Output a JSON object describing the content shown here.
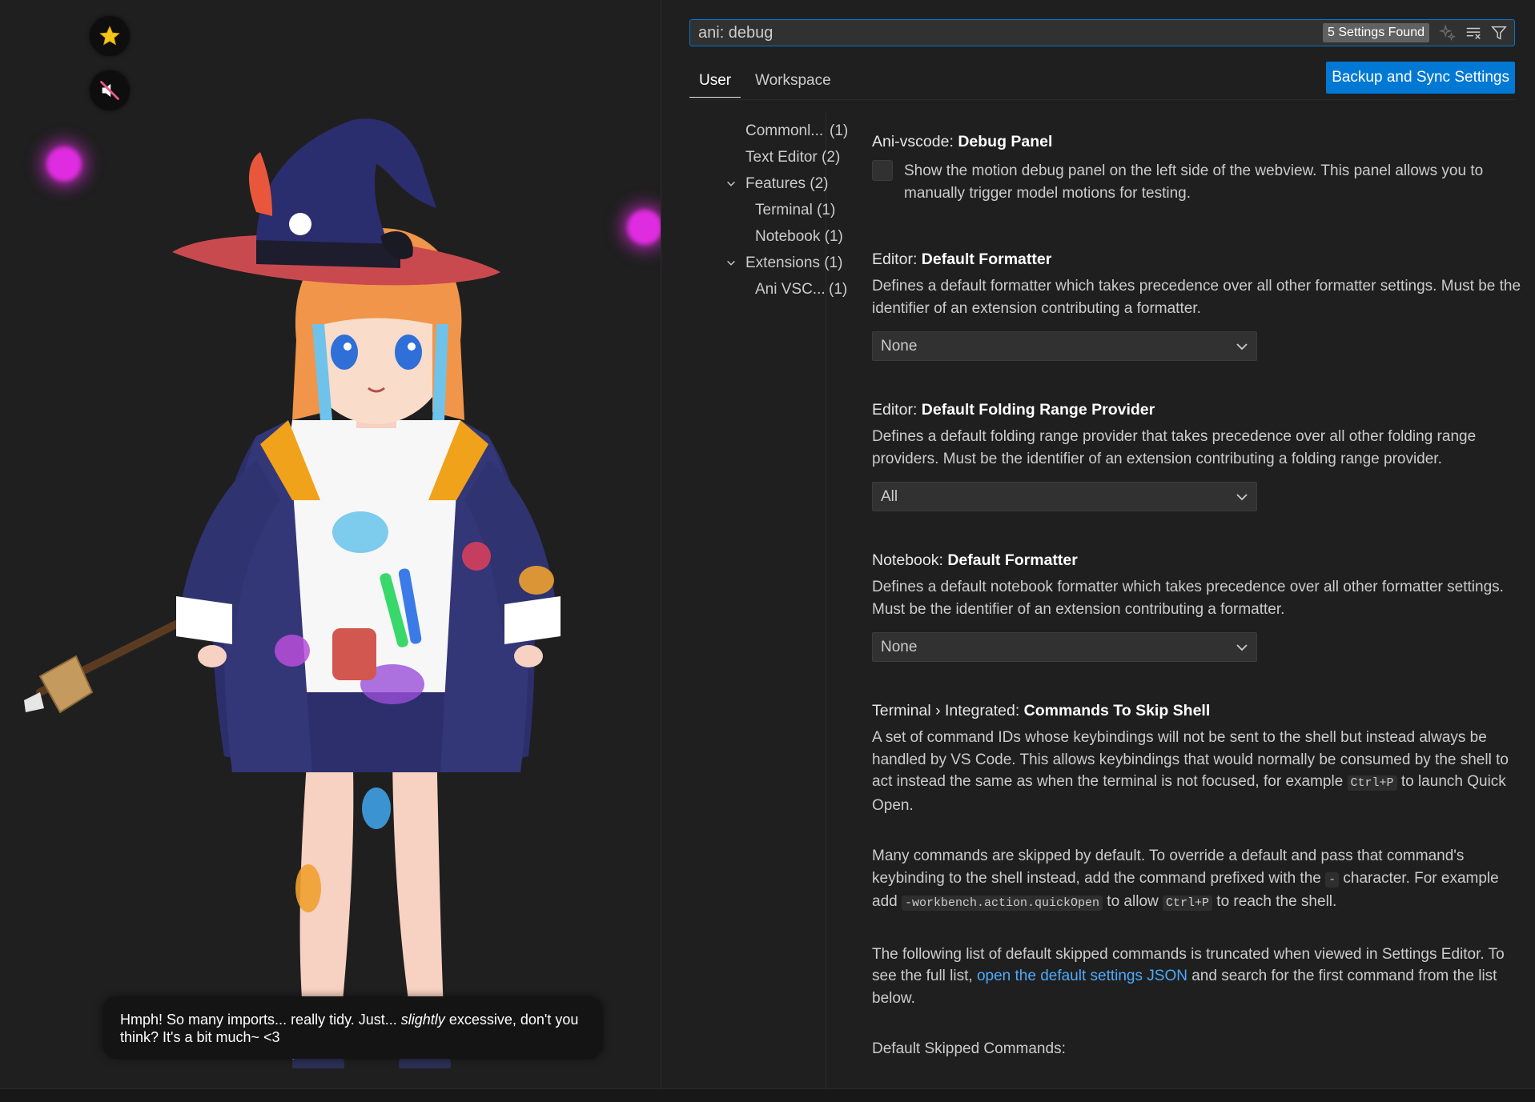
{
  "left_panel": {
    "buttons": [
      {
        "icon": "star-icon",
        "color": "#f5c518"
      },
      {
        "icon": "muted-speaker-icon",
        "color": "#e85a8a"
      }
    ],
    "speech_bubble": {
      "text_before": "Hmph! So many imports... really tidy. Just... ",
      "emphasis": "slightly",
      "text_after": " excessive, don't you think? It's a bit much~ <3"
    }
  },
  "settings_editor": {
    "search": {
      "value": "ani: debug",
      "results_badge": "5 Settings Found",
      "actions": [
        "sparkle-icon",
        "clear-filter-icon",
        "filter-icon"
      ]
    },
    "tabs": [
      {
        "label": "User",
        "active": true
      },
      {
        "label": "Workspace",
        "active": false
      }
    ],
    "sync_button": "Backup and Sync Settings",
    "toc": [
      {
        "label": "Commonl...",
        "count": "(1)"
      },
      {
        "label": "Text Editor",
        "count": "(2)"
      },
      {
        "label": "Features",
        "count": "(2)",
        "expanded": true
      },
      {
        "label": "Terminal",
        "count": "(1)"
      },
      {
        "label": "Notebook",
        "count": "(1)"
      },
      {
        "label": "Extensions",
        "count": "(1)",
        "expanded": true
      },
      {
        "label": "Ani VSC...",
        "count": "(1)"
      }
    ],
    "settings": [
      {
        "category": "Ani-vscode: ",
        "name": "Debug Panel",
        "type": "checkbox",
        "checked": false,
        "description": "Show the motion debug panel on the left side of the webview. This panel allows you to manually trigger model motions for testing."
      },
      {
        "category": "Editor: ",
        "name": "Default Formatter",
        "type": "select",
        "description": "Defines a default formatter which takes precedence over all other formatter settings. Must be the identifier of an extension contributing a formatter.",
        "value": "None"
      },
      {
        "category": "Editor: ",
        "name": "Default Folding Range Provider",
        "type": "select",
        "description": "Defines a default folding range provider that takes precedence over all other folding range providers. Must be the identifier of an extension contributing a folding range provider.",
        "value": "All"
      },
      {
        "category": "Notebook: ",
        "name": "Default Formatter",
        "type": "select",
        "description": "Defines a default notebook formatter which takes precedence over all other formatter settings. Must be the identifier of an extension contributing a formatter.",
        "value": "None"
      },
      {
        "category": "Terminal › Integrated: ",
        "name": "Commands To Skip Shell",
        "type": "text",
        "paragraph1": {
          "text": "A set of command IDs whose keybindings will not be sent to the shell but instead always be handled by VS Code. This allows keybindings that would normally be consumed by the shell to act instead the same as when the terminal is not focused, for example ",
          "code": "Ctrl+P",
          "text_after": " to launch Quick Open."
        },
        "paragraph2": {
          "text1": "Many commands are skipped by default. To override a default and pass that command's keybinding to the shell instead, add the command prefixed with the ",
          "code1": "-",
          "text2": " character. For example add ",
          "code2": "-workbench.action.quickOpen",
          "text3": " to allow ",
          "code3": "Ctrl+P",
          "text4": " to reach the shell."
        },
        "paragraph3": {
          "text1": "The following list of default skipped commands is truncated when viewed in Settings Editor. To see the full list, ",
          "link": "open the default settings JSON",
          "text2": " and search for the first command from the list below."
        },
        "paragraph4": "Default Skipped Commands:"
      }
    ]
  }
}
